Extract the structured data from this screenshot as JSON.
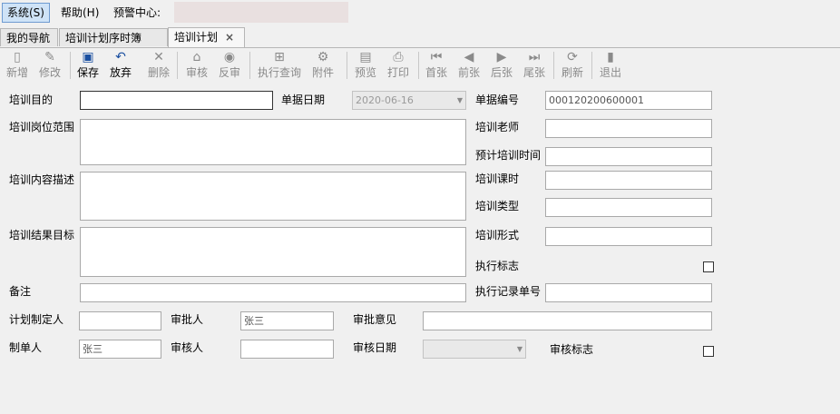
{
  "menu": {
    "system": "系统(S)",
    "help": "帮助(H)",
    "alert_center": "预警中心:"
  },
  "tabs": [
    {
      "label": "我的导航"
    },
    {
      "label": "培训计划序时簿"
    },
    {
      "label": "培训计划",
      "close": "×"
    }
  ],
  "toolbar": {
    "new": "新增",
    "edit": "修改",
    "save": "保存",
    "discard": "放弃",
    "delete": "删除",
    "audit": "审核",
    "unaudit": "反审",
    "exec_query": "执行查询",
    "attachment": "附件",
    "preview": "预览",
    "print": "打印",
    "first": "首张",
    "prev": "前张",
    "next": "后张",
    "last": "尾张",
    "refresh": "刷新",
    "exit": "退出"
  },
  "form": {
    "purpose_label": "培训目的",
    "doc_date_label": "单据日期",
    "doc_date_value": "2020-06-16",
    "doc_no_label": "单据编号",
    "doc_no_value": "000120200600001",
    "scope_label": "培训岗位范围",
    "teacher_label": "培训老师",
    "planned_time_label": "预计培训时间",
    "content_label": "培训内容描述",
    "hours_label": "培训课时",
    "type_label": "培训类型",
    "goal_label": "培训结果目标",
    "form_label": "培训形式",
    "exec_flag_label": "执行标志",
    "remark_label": "备注",
    "exec_record_label": "执行记录单号",
    "planner_label": "计划制定人",
    "approver_label": "审批人",
    "approver_value": "张三",
    "approval_opinion_label": "审批意见",
    "maker_label": "制单人",
    "maker_value": "张三",
    "auditor_label": "审核人",
    "audit_date_label": "审核日期",
    "audit_flag_label": "审核标志"
  }
}
